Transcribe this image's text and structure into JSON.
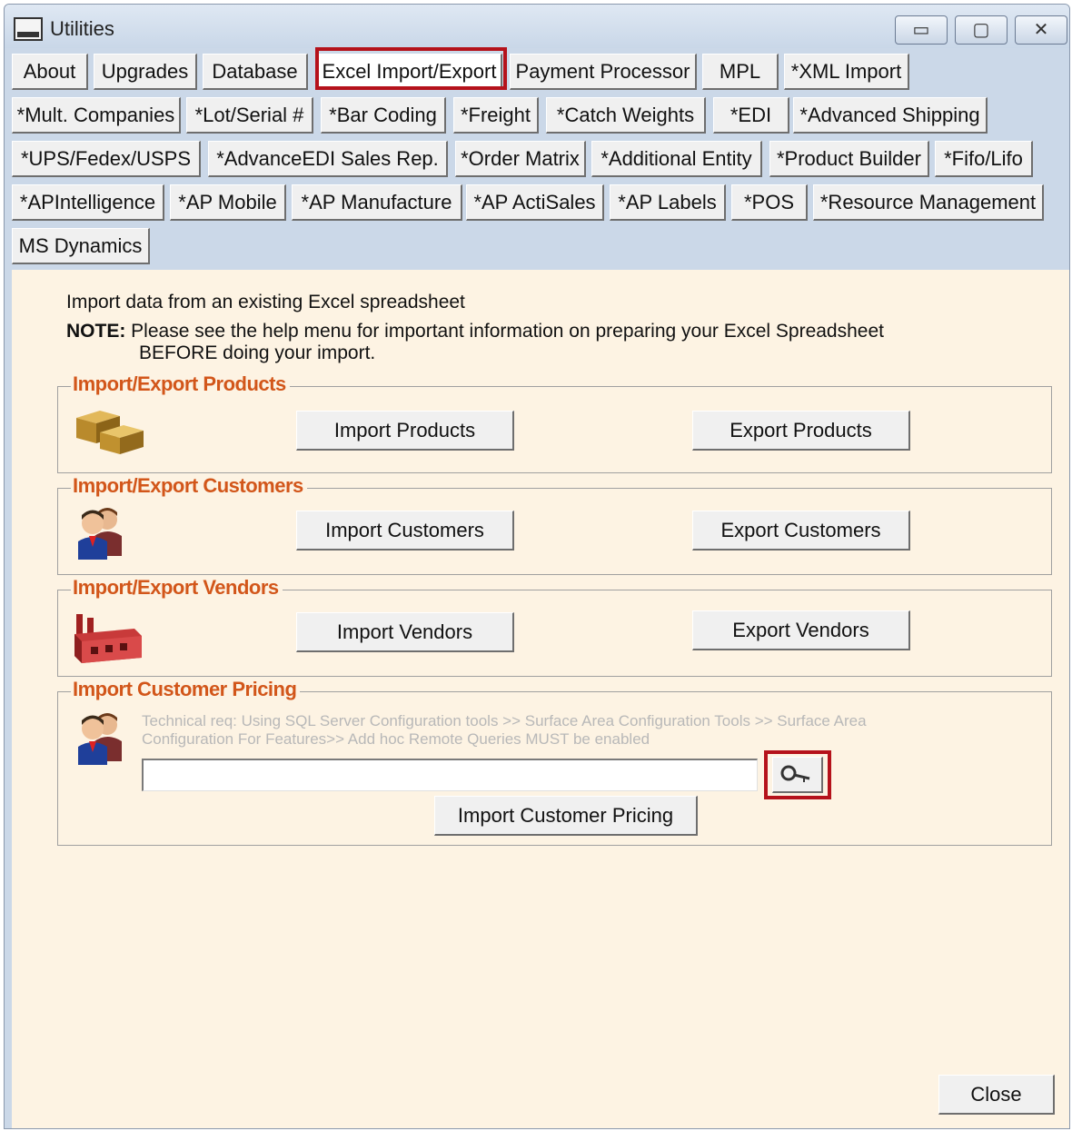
{
  "window": {
    "title": "Utilities"
  },
  "controls": {
    "minimize": "▭",
    "maximize": "▢",
    "close": "✕"
  },
  "tabs": [
    "About",
    "Upgrades",
    "Database",
    "Excel Import/Export",
    "Payment Processor",
    "MPL",
    "*XML Import",
    "*Mult. Companies",
    "*Lot/Serial #",
    "*Bar Coding",
    "*Freight",
    "*Catch Weights",
    "*EDI",
    "*Advanced Shipping",
    "*UPS/Fedex/USPS",
    "*AdvanceEDI Sales Rep.",
    "*Order Matrix",
    "*Additional Entity",
    "*Product Builder",
    "*Fifo/Lifo",
    "*APIntelligence",
    "*AP Mobile",
    "*AP Manufacture",
    "*AP ActiSales",
    "*AP Labels",
    "*POS",
    "*Resource Management",
    "MS Dynamics"
  ],
  "intro": {
    "line1": "Import data from an existing Excel spreadsheet",
    "note_label": "NOTE:",
    "note_text": "Please see the help menu for important information on preparing your Excel Spreadsheet",
    "note_text2": "BEFORE doing your import."
  },
  "groups": {
    "products": {
      "title": "Import/Export Products",
      "import": "Import Products",
      "export": "Export Products",
      "icon": "boxes-icon"
    },
    "customers": {
      "title": "Import/Export Customers",
      "import": "Import Customers",
      "export": "Export Customers",
      "icon": "people-icon"
    },
    "vendors": {
      "title": "Import/Export Vendors",
      "import": "Import Vendors",
      "export": "Export Vendors",
      "icon": "factory-icon"
    },
    "pricing": {
      "title": "Import Customer Pricing",
      "tech_line1": "Technical req: Using SQL Server Configuration tools >> Surface Area Configuration Tools  >> Surface Area",
      "tech_line2": "Configuration For Features>> Add hoc Remote Queries MUST be enabled",
      "path_value": "",
      "import": "Import Customer Pricing",
      "icon": "people-icon"
    }
  },
  "footer": {
    "close": "Close"
  },
  "colors": {
    "accent": "#d2561a",
    "highlight": "#b5121b",
    "panel": "#fdf3e3"
  }
}
